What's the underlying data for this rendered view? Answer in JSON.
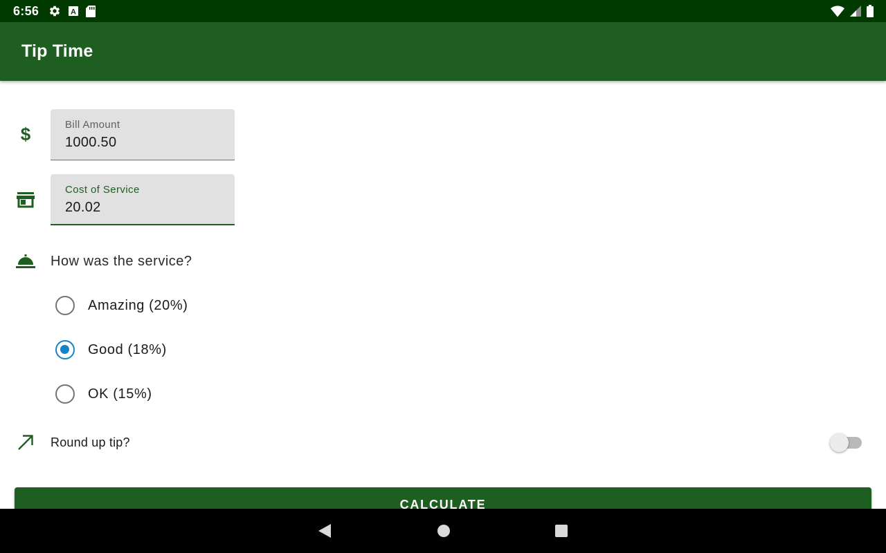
{
  "status_bar": {
    "time": "6:56",
    "left_icons": [
      "settings-icon",
      "a-notification-icon",
      "sd-card-icon"
    ],
    "right_icons": [
      "wifi-icon",
      "cell-signal-icon",
      "battery-icon"
    ]
  },
  "app_bar": {
    "title": "Tip Time"
  },
  "bill_amount": {
    "icon": "dollar-icon",
    "label": "Bill Amount",
    "value": "1000.50"
  },
  "cost_of_service": {
    "icon": "storefront-icon",
    "label": "Cost of Service",
    "value": "20.02"
  },
  "service_question": {
    "icon": "room-service-icon",
    "text": "How was the service?"
  },
  "tip_options": [
    {
      "label": "Amazing (20%)",
      "selected": false
    },
    {
      "label": "Good (18%)",
      "selected": true
    },
    {
      "label": "OK (15%)",
      "selected": false
    }
  ],
  "round_up": {
    "icon": "trending-up-icon",
    "label": "Round up tip?",
    "enabled": false
  },
  "calculate_button": {
    "label": "CALCULATE"
  },
  "nav_bar": {
    "buttons": [
      "back-icon",
      "home-icon",
      "recents-icon"
    ]
  },
  "colors": {
    "status_bar": "#003a00",
    "primary": "#1e5e20",
    "radio_accent": "#1383c8",
    "field_bg": "#e1e1e1"
  }
}
